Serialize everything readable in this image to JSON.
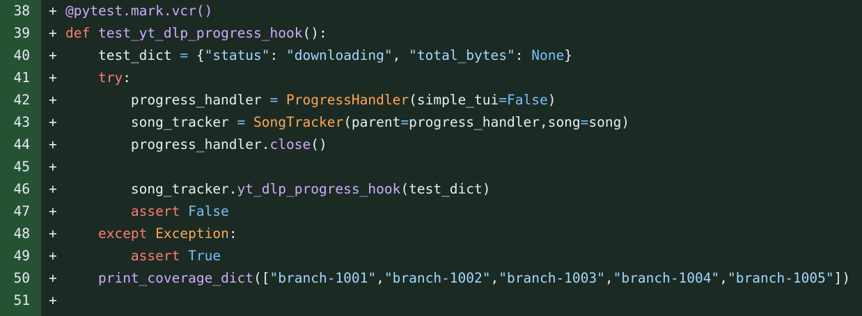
{
  "colors": {
    "gutter_bg": "#265234",
    "code_bg": "#1b2b23",
    "keyword": "#ff7b72",
    "function": "#d2a8ff",
    "class": "#ffa657",
    "string": "#a5d6ff",
    "constant": "#79c0ff",
    "text": "#e6edf3"
  },
  "lines": [
    {
      "number": "38",
      "marker": "+",
      "tokens": [
        {
          "t": "dec",
          "v": "@pytest.mark.vcr()"
        }
      ]
    },
    {
      "number": "39",
      "marker": "+",
      "tokens": [
        {
          "t": "kw",
          "v": "def"
        },
        {
          "t": "plain",
          "v": " "
        },
        {
          "t": "fn",
          "v": "test_yt_dlp_progress_hook"
        },
        {
          "t": "plain",
          "v": "():"
        }
      ]
    },
    {
      "number": "40",
      "marker": "+",
      "tokens": [
        {
          "t": "plain",
          "v": "    test_dict "
        },
        {
          "t": "op",
          "v": "="
        },
        {
          "t": "plain",
          "v": " {"
        },
        {
          "t": "str",
          "v": "\"status\""
        },
        {
          "t": "plain",
          "v": ": "
        },
        {
          "t": "str",
          "v": "\"downloading\""
        },
        {
          "t": "plain",
          "v": ", "
        },
        {
          "t": "str",
          "v": "\"total_bytes\""
        },
        {
          "t": "plain",
          "v": ": "
        },
        {
          "t": "const",
          "v": "None"
        },
        {
          "t": "plain",
          "v": "}"
        }
      ]
    },
    {
      "number": "41",
      "marker": "+",
      "tokens": [
        {
          "t": "plain",
          "v": "    "
        },
        {
          "t": "kw",
          "v": "try"
        },
        {
          "t": "plain",
          "v": ":"
        }
      ]
    },
    {
      "number": "42",
      "marker": "+",
      "tokens": [
        {
          "t": "plain",
          "v": "        progress_handler "
        },
        {
          "t": "op",
          "v": "="
        },
        {
          "t": "plain",
          "v": " "
        },
        {
          "t": "cls",
          "v": "ProgressHandler"
        },
        {
          "t": "plain",
          "v": "(simple_tui"
        },
        {
          "t": "op",
          "v": "="
        },
        {
          "t": "const",
          "v": "False"
        },
        {
          "t": "plain",
          "v": ")"
        }
      ]
    },
    {
      "number": "43",
      "marker": "+",
      "tokens": [
        {
          "t": "plain",
          "v": "        song_tracker "
        },
        {
          "t": "op",
          "v": "="
        },
        {
          "t": "plain",
          "v": " "
        },
        {
          "t": "cls",
          "v": "SongTracker"
        },
        {
          "t": "plain",
          "v": "(parent"
        },
        {
          "t": "op",
          "v": "="
        },
        {
          "t": "plain",
          "v": "progress_handler,song"
        },
        {
          "t": "op",
          "v": "="
        },
        {
          "t": "plain",
          "v": "song)"
        }
      ]
    },
    {
      "number": "44",
      "marker": "+",
      "tokens": [
        {
          "t": "plain",
          "v": "        progress_handler."
        },
        {
          "t": "fn",
          "v": "close"
        },
        {
          "t": "plain",
          "v": "()"
        }
      ]
    },
    {
      "number": "45",
      "marker": "+",
      "tokens": []
    },
    {
      "number": "46",
      "marker": "+",
      "tokens": [
        {
          "t": "plain",
          "v": "        song_tracker."
        },
        {
          "t": "fn",
          "v": "yt_dlp_progress_hook"
        },
        {
          "t": "plain",
          "v": "(test_dict)"
        }
      ]
    },
    {
      "number": "47",
      "marker": "+",
      "tokens": [
        {
          "t": "plain",
          "v": "        "
        },
        {
          "t": "kw",
          "v": "assert"
        },
        {
          "t": "plain",
          "v": " "
        },
        {
          "t": "const",
          "v": "False"
        }
      ]
    },
    {
      "number": "48",
      "marker": "+",
      "tokens": [
        {
          "t": "plain",
          "v": "    "
        },
        {
          "t": "kw",
          "v": "except"
        },
        {
          "t": "plain",
          "v": " "
        },
        {
          "t": "cls",
          "v": "Exception"
        },
        {
          "t": "plain",
          "v": ":"
        }
      ]
    },
    {
      "number": "49",
      "marker": "+",
      "tokens": [
        {
          "t": "plain",
          "v": "        "
        },
        {
          "t": "kw",
          "v": "assert"
        },
        {
          "t": "plain",
          "v": " "
        },
        {
          "t": "const",
          "v": "True"
        }
      ]
    },
    {
      "number": "50",
      "marker": "+",
      "tokens": [
        {
          "t": "plain",
          "v": "    "
        },
        {
          "t": "fn",
          "v": "print_coverage_dict"
        },
        {
          "t": "plain",
          "v": "(["
        },
        {
          "t": "str",
          "v": "\"branch-1001\""
        },
        {
          "t": "plain",
          "v": ","
        },
        {
          "t": "str",
          "v": "\"branch-1002\""
        },
        {
          "t": "plain",
          "v": ","
        },
        {
          "t": "str",
          "v": "\"branch-1003\""
        },
        {
          "t": "plain",
          "v": ","
        },
        {
          "t": "str",
          "v": "\"branch-1004\""
        },
        {
          "t": "plain",
          "v": ","
        },
        {
          "t": "str",
          "v": "\"branch-1005\""
        },
        {
          "t": "plain",
          "v": "])"
        }
      ]
    },
    {
      "number": "51",
      "marker": "+",
      "tokens": []
    }
  ]
}
